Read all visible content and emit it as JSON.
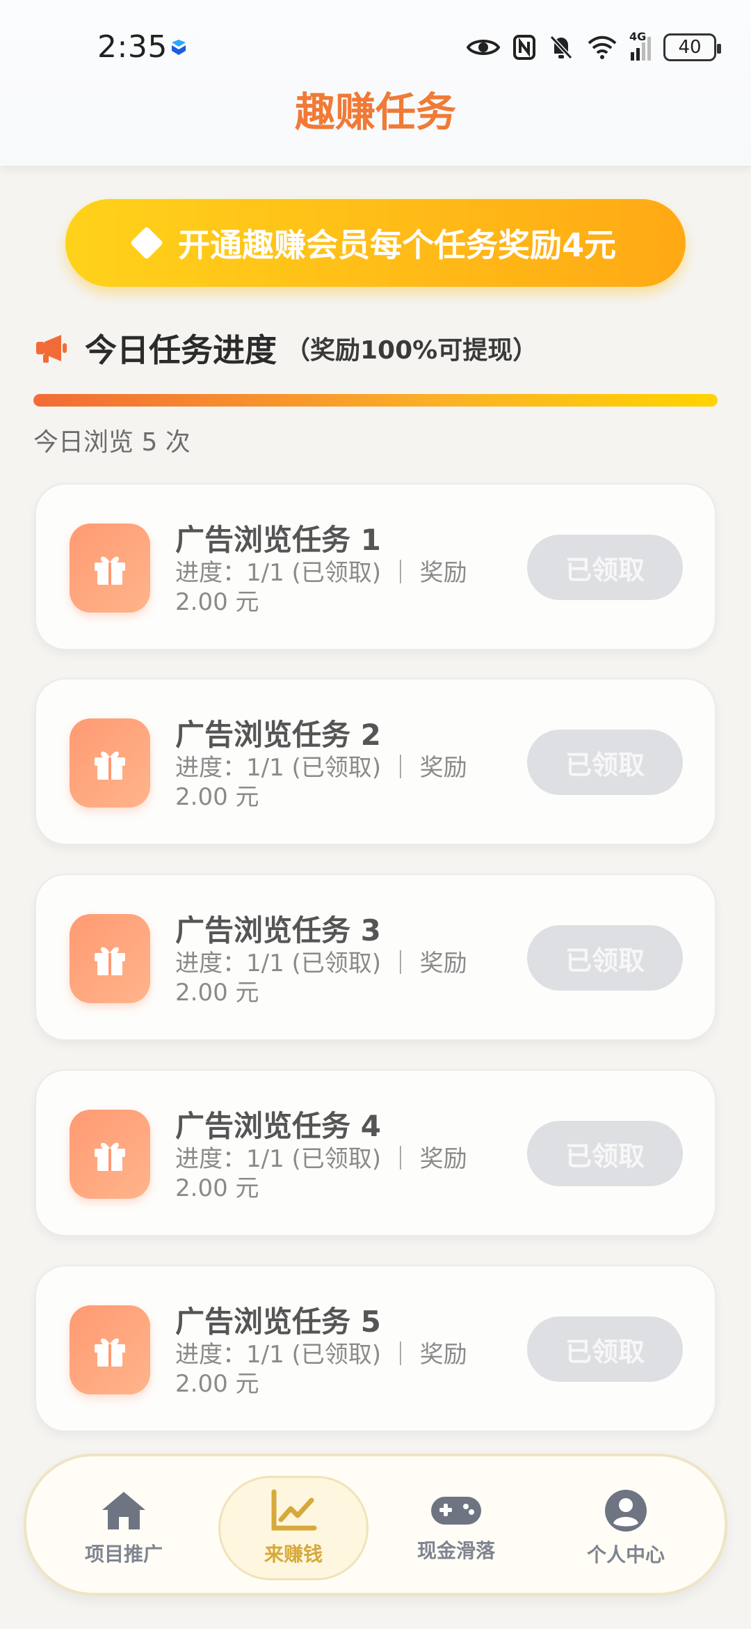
{
  "status_bar": {
    "time": "2:35",
    "battery": "40",
    "network": "4G"
  },
  "header": {
    "title": "趣赚任务"
  },
  "banner": {
    "text": "开通趣赚会员每个任务奖励4元",
    "icon": "diamond-icon"
  },
  "section": {
    "title": "今日任务进度",
    "subtitle": "（奖励100%可提现）",
    "icon": "megaphone-icon",
    "progress_fraction": 1.0,
    "browse_count": "今日浏览 5 次"
  },
  "tasks": [
    {
      "title": "广告浏览任务 1",
      "meta": "进度：1/1 (已领取) ｜ 奖励 2.00 元",
      "button": "已领取"
    },
    {
      "title": "广告浏览任务 2",
      "meta": "进度：1/1 (已领取) ｜ 奖励 2.00 元",
      "button": "已领取"
    },
    {
      "title": "广告浏览任务 3",
      "meta": "进度：1/1 (已领取) ｜ 奖励 2.00 元",
      "button": "已领取"
    },
    {
      "title": "广告浏览任务 4",
      "meta": "进度：1/1 (已领取) ｜ 奖励 2.00 元",
      "button": "已领取"
    },
    {
      "title": "广告浏览任务 5",
      "meta": "进度：1/1 (已领取) ｜ 奖励 2.00 元",
      "button": "已领取"
    }
  ],
  "bottom_nav": [
    {
      "label": "项目推广",
      "icon": "home-icon",
      "active": false
    },
    {
      "label": "来赚钱",
      "icon": "chart-line-icon",
      "active": true
    },
    {
      "label": "现金滑落",
      "icon": "gamepad-icon",
      "active": false
    },
    {
      "label": "个人中心",
      "icon": "user-icon",
      "active": false
    }
  ],
  "colors": {
    "accent": "#f07a36",
    "banner_start": "#ffd21a",
    "banner_end": "#ffa915",
    "gift_bg": "#ff9a73",
    "disabled_btn": "#dedfe2",
    "nav_active": "#d6a93a"
  }
}
